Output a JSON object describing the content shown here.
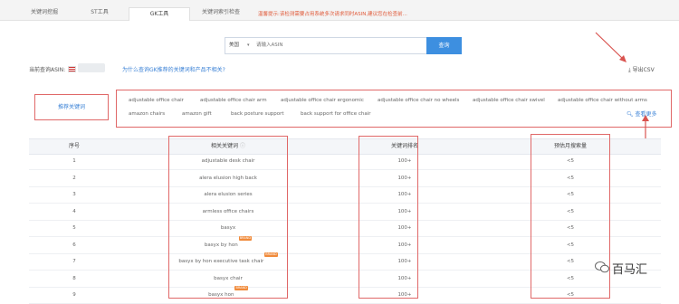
{
  "tabs": [
    "关键词挖掘",
    "ST工具",
    "GK工具",
    "关键词索引检查"
  ],
  "tabs_note": "温馨提示:该检测需要占用系统多次请求同时ASIN,建议您在检查前...",
  "search": {
    "select_label": "美国",
    "placeholder": "请输入ASIN",
    "button_label": "查询"
  },
  "asin": {
    "label": "当前查询ASIN:",
    "question": "为什么查询GK推荐的关键词和产品不相关?"
  },
  "export_label": "导出CSV",
  "recommend": {
    "label": "推荐关键词",
    "row1": [
      "adjustable office chair",
      "adjustable office chair arm",
      "adjustable office chair ergonomic",
      "adjustable office chair no wheels",
      "adjustable office chair swivel",
      "adjustable office chair without arms"
    ],
    "row2": [
      "amazon chairs",
      "amazon gift",
      "back posture support",
      "back support for office chair"
    ],
    "more_label": "查看更多"
  },
  "table": {
    "headers": [
      "序号",
      "相关关键词",
      "关键词排名",
      "预估月搜索量"
    ],
    "rows": [
      {
        "no": "1",
        "keyword": "adjustable desk chair",
        "rank": "100+",
        "volume": "<5",
        "badge": ""
      },
      {
        "no": "2",
        "keyword": "alera elusion high back",
        "rank": "100+",
        "volume": "<5",
        "badge": ""
      },
      {
        "no": "3",
        "keyword": "alera elusion series",
        "rank": "100+",
        "volume": "<5",
        "badge": ""
      },
      {
        "no": "4",
        "keyword": "armless office chairs",
        "rank": "100+",
        "volume": "<5",
        "badge": ""
      },
      {
        "no": "5",
        "keyword": "basyx",
        "rank": "100+",
        "volume": "<5",
        "badge": ""
      },
      {
        "no": "6",
        "keyword": "basyx by hon",
        "rank": "100+",
        "volume": "<5",
        "badge": "BRAND"
      },
      {
        "no": "7",
        "keyword": "basyx by hon executive task chair",
        "rank": "100+",
        "volume": "<5",
        "badge": "BRAND"
      },
      {
        "no": "8",
        "keyword": "basyx chair",
        "rank": "100+",
        "volume": "<5",
        "badge": ""
      },
      {
        "no": "9",
        "keyword": "basyx hon",
        "rank": "100+",
        "volume": "<5",
        "badge": "BRAND"
      }
    ]
  },
  "watermark": "百马汇",
  "colors": {
    "accent": "#3d8fe0",
    "annotation": "#e06868",
    "badge": "#f08a3a",
    "note": "#e05a3a"
  }
}
